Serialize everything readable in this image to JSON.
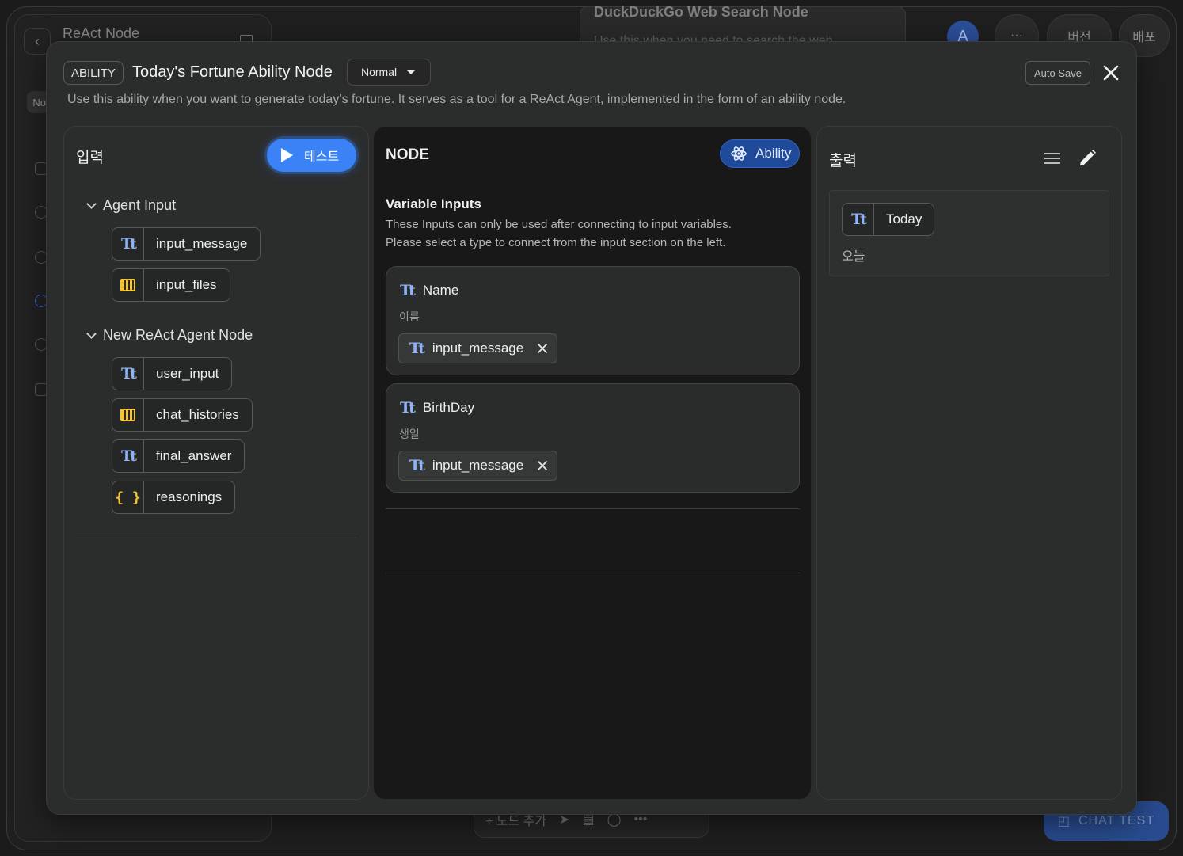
{
  "background": {
    "panel_title": "ReAct Node",
    "sidebar_tab": "No",
    "node_card_title": "DuckDuckGo Web Search Node",
    "node_card_subtitle": "Use this when you need to search the web",
    "avatar_initial": "A",
    "more_label": "···",
    "version_label": "버전",
    "deploy_label": "배포",
    "add_node_label": "+ 노드 추가",
    "chat_test_label": "CHAT TEST"
  },
  "modal": {
    "type_badge": "ABILITY",
    "title": "Today's Fortune Ability Node",
    "mode": "Normal",
    "auto_save": "Auto Save",
    "description": "Use this ability when you want to generate today’s fortune. It serves as a tool for a ReAct Agent, implemented in the form of an ability node."
  },
  "input_panel": {
    "heading": "입력",
    "test_button": "테스트",
    "groups": [
      {
        "name": "Agent Input",
        "items": [
          {
            "label": "input_message",
            "type": "text"
          },
          {
            "label": "input_files",
            "type": "array"
          }
        ]
      },
      {
        "name": "New ReAct Agent Node",
        "items": [
          {
            "label": "user_input",
            "type": "text"
          },
          {
            "label": "chat_histories",
            "type": "array"
          },
          {
            "label": "final_answer",
            "type": "text"
          },
          {
            "label": "reasonings",
            "type": "object"
          }
        ]
      }
    ]
  },
  "node_panel": {
    "heading": "NODE",
    "ability_badge": "Ability",
    "variable_inputs_title": "Variable Inputs",
    "variable_inputs_desc_1": "These Inputs can only be used after connecting to input variables.",
    "variable_inputs_desc_2": "Please select a type to connect from the input section on the left.",
    "fields": [
      {
        "name": "Name",
        "subtitle": "이름",
        "connected": "input_message"
      },
      {
        "name": "BirthDay",
        "subtitle": "생일",
        "connected": "input_message"
      }
    ]
  },
  "output_panel": {
    "heading": "출력",
    "outputs": [
      {
        "label": "Today",
        "subtitle": "오늘",
        "type": "text"
      }
    ]
  },
  "icons": {
    "text_type": "Tt",
    "object_type": "{ }"
  },
  "colors": {
    "accent_blue": "#3b82f6",
    "ability_badge": "#1f4a9a",
    "text_type_icon": "#8fb3f5",
    "array_type_icon": "#f3c531"
  }
}
